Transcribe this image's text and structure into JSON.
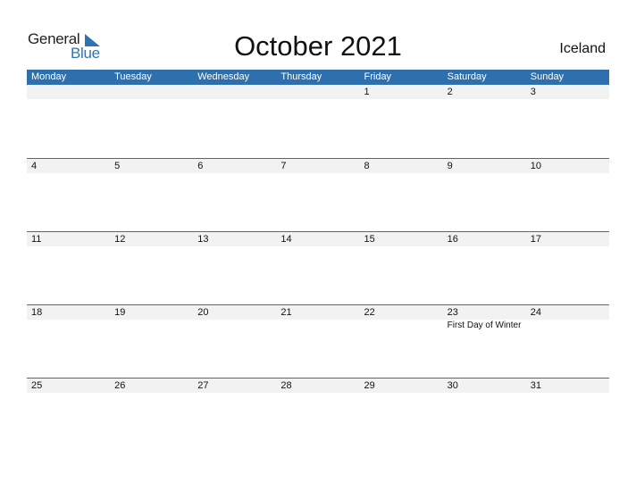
{
  "logo": {
    "line1": "General",
    "line2": "Blue"
  },
  "title": "October 2021",
  "country": "Iceland",
  "weekdays": [
    "Monday",
    "Tuesday",
    "Wednesday",
    "Thursday",
    "Friday",
    "Saturday",
    "Sunday"
  ],
  "weeks": [
    {
      "days": [
        "",
        "",
        "",
        "",
        "1",
        "2",
        "3"
      ],
      "events": [
        "",
        "",
        "",
        "",
        "",
        "",
        ""
      ]
    },
    {
      "days": [
        "4",
        "5",
        "6",
        "7",
        "8",
        "9",
        "10"
      ],
      "events": [
        "",
        "",
        "",
        "",
        "",
        "",
        ""
      ]
    },
    {
      "days": [
        "11",
        "12",
        "13",
        "14",
        "15",
        "16",
        "17"
      ],
      "events": [
        "",
        "",
        "",
        "",
        "",
        "",
        ""
      ]
    },
    {
      "days": [
        "18",
        "19",
        "20",
        "21",
        "22",
        "23",
        "24"
      ],
      "events": [
        "",
        "",
        "",
        "",
        "",
        "First Day of Winter",
        ""
      ]
    },
    {
      "days": [
        "25",
        "26",
        "27",
        "28",
        "29",
        "30",
        "31"
      ],
      "events": [
        "",
        "",
        "",
        "",
        "",
        "",
        ""
      ]
    }
  ],
  "colors": {
    "header": "#2e6fad",
    "brand": "#2e74b5",
    "band": "#f2f2f2"
  }
}
